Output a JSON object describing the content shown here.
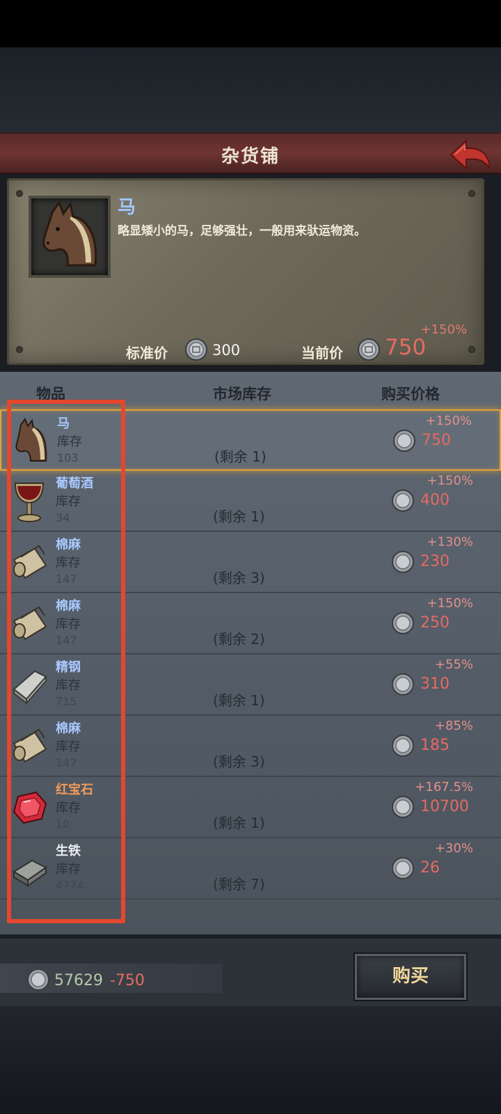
{
  "title": "杂货铺",
  "detail": {
    "name": "马",
    "description": "略显矮小的马，足够强壮，一般用来驮运物资。",
    "percent": "+150%",
    "standard_label": "标准价",
    "standard_price": "300",
    "current_label": "当前价",
    "current_price": "750"
  },
  "columns": {
    "item": "物品",
    "stock": "市场库存",
    "price": "购买价格"
  },
  "rows": [
    {
      "name": "马",
      "stock_label": "库存",
      "stock": "103",
      "remain": "(剩余 1)",
      "percent": "+150%",
      "price": "750",
      "icon": "horse-icon"
    },
    {
      "name": "葡萄酒",
      "stock_label": "库存",
      "stock": "34",
      "remain": "(剩余 1)",
      "percent": "+150%",
      "price": "400",
      "icon": "wine-goblet-icon"
    },
    {
      "name": "棉麻",
      "stock_label": "库存",
      "stock": "147",
      "remain": "(剩余 3)",
      "percent": "+130%",
      "price": "230",
      "icon": "cloth-roll-icon"
    },
    {
      "name": "棉麻",
      "stock_label": "库存",
      "stock": "147",
      "remain": "(剩余 2)",
      "percent": "+150%",
      "price": "250",
      "icon": "cloth-roll-icon"
    },
    {
      "name": "精钢",
      "stock_label": "库存",
      "stock": "715",
      "remain": "(剩余 1)",
      "percent": "+55%",
      "price": "310",
      "icon": "steel-bar-icon"
    },
    {
      "name": "棉麻",
      "stock_label": "库存",
      "stock": "147",
      "remain": "(剩余 3)",
      "percent": "+85%",
      "price": "185",
      "icon": "cloth-roll-icon"
    },
    {
      "name": "红宝石",
      "stock_label": "库存",
      "stock": "10",
      "remain": "(剩余 1)",
      "percent": "+167.5%",
      "price": "10700",
      "icon": "ruby-icon"
    },
    {
      "name": "生铁",
      "stock_label": "库存",
      "stock": "4774",
      "remain": "(剩余 7)",
      "percent": "+30%",
      "price": "26",
      "icon": "iron-ingot-icon"
    }
  ],
  "wallet": {
    "money": "57629",
    "delta": "-750"
  },
  "buy_button": "购买",
  "colors": {
    "title_bar": "#6e3431",
    "price_red": "#e56b62",
    "name_blue": "#a9c9ff",
    "rare_orange": "#f19a5a",
    "highlight_red": "#e5472d",
    "selection_gold": "#e3a437"
  }
}
